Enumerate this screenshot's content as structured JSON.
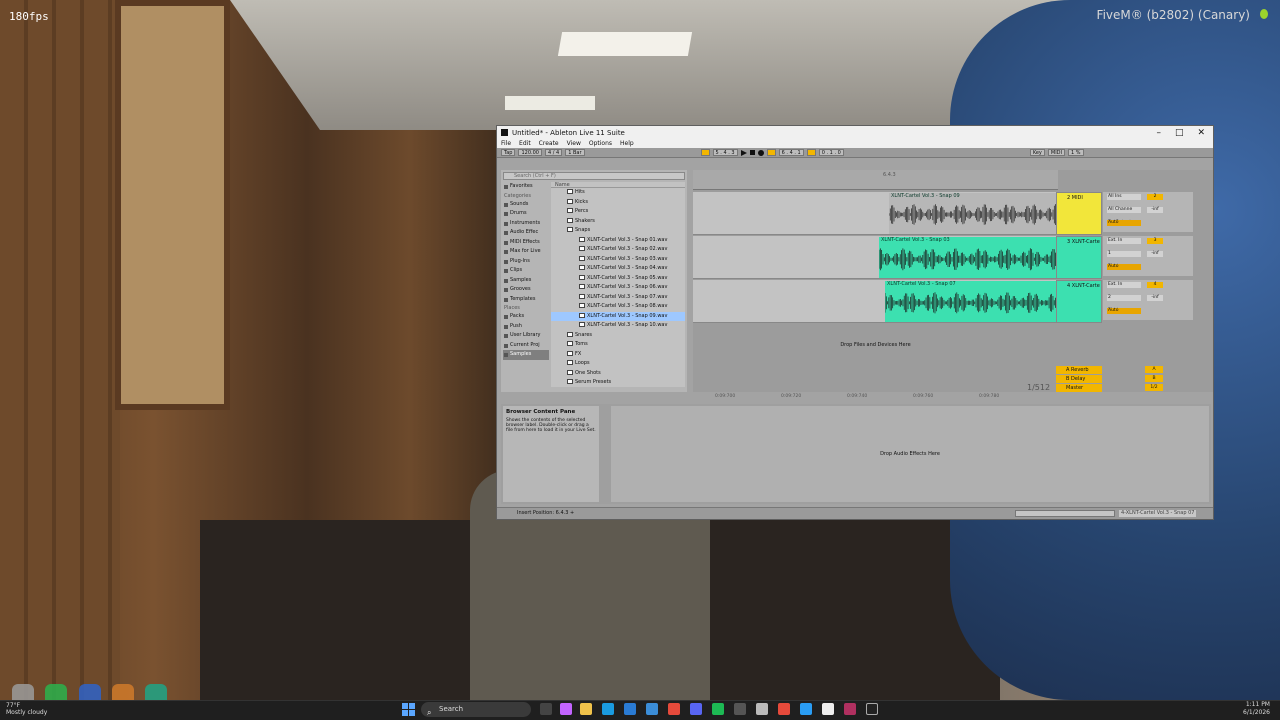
{
  "overlay": {
    "fps": "180fps",
    "fivem": "FiveM® (b2802) (Canary)"
  },
  "window": {
    "title": "Untitled* - Ableton Live 11 Suite"
  },
  "menu": [
    "File",
    "Edit",
    "Create",
    "View",
    "Options",
    "Help"
  ],
  "transport": {
    "tap": "Tap",
    "tempo": "120.00",
    "signature": "4 / 4",
    "quant": "1 Bar",
    "position": "5 . 4 . 3",
    "loop_start": "6 . 4 . 1",
    "loop_len": "0 . 1 . 0",
    "key": "Key",
    "midi": "MIDI",
    "cpu": "1 %"
  },
  "browser": {
    "search_placeholder": "Search (Ctrl + F)",
    "favorites": "Favorites",
    "categories_label": "Categories",
    "categories": [
      "Sounds",
      "Drums",
      "Instruments",
      "Audio Effec",
      "MIDI Effects",
      "Max for Live",
      "Plug-Ins",
      "Clips",
      "Samples",
      "Grooves",
      "Templates"
    ],
    "places_label": "Places",
    "places": [
      "Packs",
      "Push",
      "User Library",
      "Current Proj",
      "Samples"
    ],
    "name_header": "Name",
    "items": [
      {
        "label": "Hits",
        "type": "folder"
      },
      {
        "label": "Kicks",
        "type": "folder"
      },
      {
        "label": "Percs",
        "type": "folder"
      },
      {
        "label": "Shakers",
        "type": "folder"
      },
      {
        "label": "Snaps",
        "type": "folder-open"
      },
      {
        "label": "XLNT-Cartel Vol.3 - Snap 01.wav",
        "type": "file"
      },
      {
        "label": "XLNT-Cartel Vol.3 - Snap 02.wav",
        "type": "file"
      },
      {
        "label": "XLNT-Cartel Vol.3 - Snap 03.wav",
        "type": "file"
      },
      {
        "label": "XLNT-Cartel Vol.3 - Snap 04.wav",
        "type": "file"
      },
      {
        "label": "XLNT-Cartel Vol.3 - Snap 05.wav",
        "type": "file"
      },
      {
        "label": "XLNT-Cartel Vol.3 - Snap 06.wav",
        "type": "file"
      },
      {
        "label": "XLNT-Cartel Vol.3 - Snap 07.wav",
        "type": "file"
      },
      {
        "label": "XLNT-Cartel Vol.3 - Snap 08.wav",
        "type": "file"
      },
      {
        "label": "XLNT-Cartel Vol.3 - Snap 09.wav",
        "type": "file",
        "selected": true
      },
      {
        "label": "XLNT-Cartel Vol.3 - Snap 10.wav",
        "type": "file"
      },
      {
        "label": "Snares",
        "type": "folder"
      },
      {
        "label": "Toms",
        "type": "folder"
      },
      {
        "label": "FX",
        "type": "folder"
      },
      {
        "label": "Loops",
        "type": "folder"
      },
      {
        "label": "One Shots",
        "type": "folder"
      },
      {
        "label": "Serum Presets",
        "type": "folder"
      }
    ]
  },
  "arrangement": {
    "ruler_mark": "6.4.3",
    "tracks": [
      {
        "clip": "XLNT-Cartel Vol.3 - Snap 09",
        "header": "2 MIDI",
        "in": "All Ins",
        "ch": "All Channe",
        "out": "No Output",
        "num": "2",
        "color": "#f2e63a"
      },
      {
        "clip": "XLNT-Cartel Vol.3 - Snap 03",
        "header": "3 XLNT-Carte",
        "in": "Ext. In",
        "ch": "1",
        "out": "Master",
        "num": "3",
        "color": "#3ce0b0"
      },
      {
        "clip": "XLNT-Cartel Vol.3 - Snap 07",
        "header": "4 XLNT-Carte",
        "in": "Ext. In",
        "ch": "2",
        "out": "Master",
        "num": "4",
        "color": "#3ce0b0"
      }
    ],
    "drop_text": "Drop Files and Devices Here",
    "returns": [
      "A Reverb",
      "B Delay",
      "Master"
    ],
    "return_sends": [
      "A",
      "B",
      "1/2"
    ],
    "ratio": "1/512",
    "timeline": [
      "0:09:700",
      "0:09:720",
      "0:09:740",
      "0:09:760",
      "0:09:780"
    ],
    "monitor": [
      "Auto",
      "Off"
    ],
    "inf": "-inf"
  },
  "detail": {
    "info_title": "Browser Content Pane",
    "info_text": "Shows the contents of the selected browser label. Double-click or drag a file from here to load it in your Live Set.",
    "drop_text": "Drop Audio Effects Here"
  },
  "status": {
    "insert": "Insert Position: 6.4.3 +",
    "clip": "4-XLNT-Cartel Vol.3 - Snap 07"
  },
  "taskbar": {
    "weather_temp": "77°F",
    "weather_desc": "Mostly cloudy",
    "search": "Search",
    "time": "1:11 PM",
    "date": "6/1/2026"
  }
}
